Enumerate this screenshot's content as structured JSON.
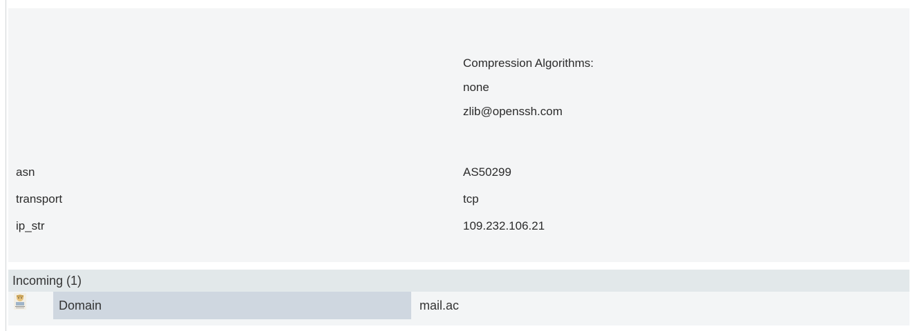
{
  "ssh_properties": {
    "compression": {
      "heading": "Compression Algorithms:",
      "items": [
        "none",
        "zlib@openssh.com"
      ]
    },
    "rows": [
      {
        "key": "asn",
        "value": "AS50299"
      },
      {
        "key": "transport",
        "value": "tcp"
      },
      {
        "key": "ip_str",
        "value": "109.232.106.21"
      }
    ]
  },
  "incoming": {
    "header": "Incoming (1)",
    "entries": [
      {
        "icon": "domain-entity-icon",
        "type": "Domain",
        "value": "mail.ac"
      }
    ]
  }
}
